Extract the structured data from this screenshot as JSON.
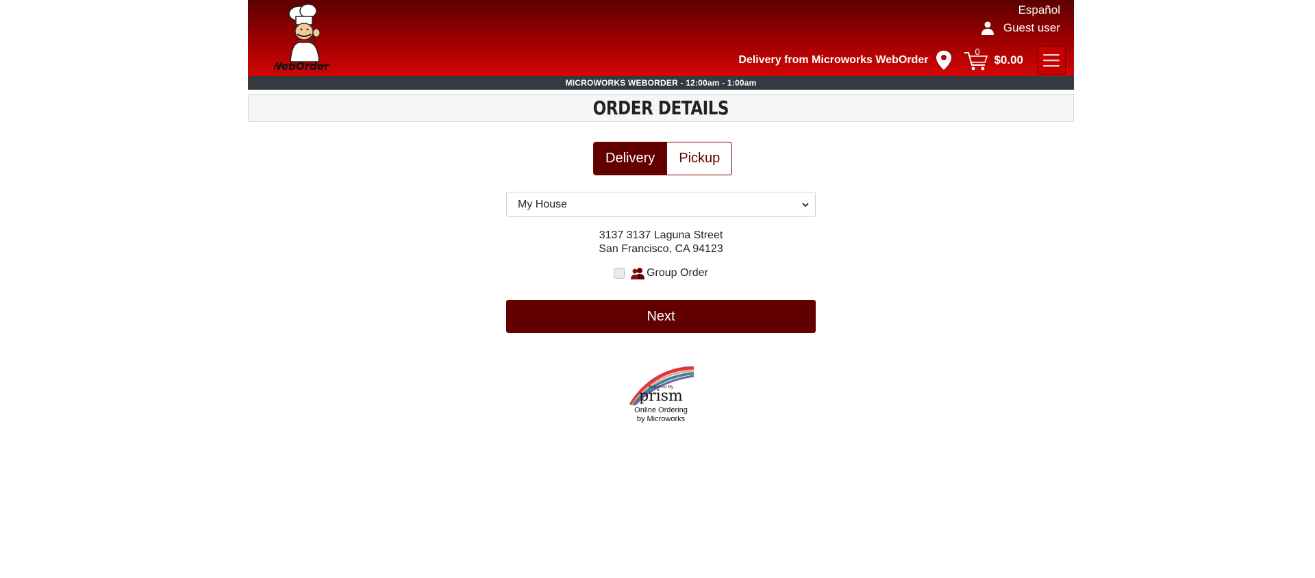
{
  "header": {
    "language": "Español",
    "user": "Guest user",
    "delivery_from": "Delivery from Microworks WebOrder",
    "cart_count": "0",
    "cart_total": "$0.00",
    "logo_text": "WebOrder",
    "icons": {
      "user": "user-icon",
      "pin": "map-pin-icon",
      "cart": "cart-icon",
      "menu": "hamburger-menu-icon"
    }
  },
  "hours_bar": "MICROWORKS WEBORDER - 12:00am - 1:00am",
  "page_title": "ORDER DETAILS",
  "order_type": {
    "options": [
      "Delivery",
      "Pickup"
    ],
    "selected": "Delivery"
  },
  "address_select": {
    "value": "My House"
  },
  "address": {
    "line1": "3137 3137 Laguna Street",
    "line2": "San Francisco, CA 94123"
  },
  "group_order": {
    "label": "Group Order",
    "checked": false
  },
  "next_label": "Next",
  "footer": {
    "logo_text": "prism",
    "logo_small": "Powered By",
    "line1": "Online Ordering",
    "line2": "by Microworks"
  },
  "colors": {
    "brand": "#620000",
    "header_top": "#5c0000",
    "header_bottom": "#d20606",
    "hours_bar": "#343a40"
  }
}
